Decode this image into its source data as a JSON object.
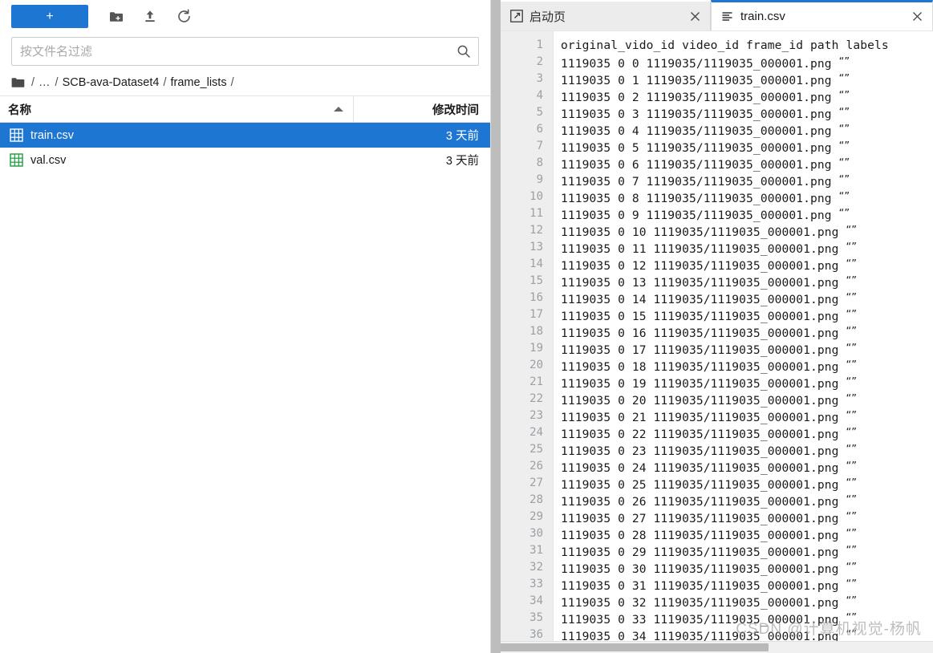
{
  "file_browser": {
    "toolbar": {
      "new_label": "+",
      "icons": [
        {
          "name": "new-folder-icon"
        },
        {
          "name": "upload-icon"
        },
        {
          "name": "refresh-icon"
        }
      ]
    },
    "filter": {
      "value": "",
      "placeholder": "按文件名过滤",
      "icon": "search-icon"
    },
    "breadcrumb": {
      "root_icon": "folder-icon",
      "separator": "/",
      "crumbs": [
        "…",
        "SCB-ava-Dataset4",
        "frame_lists"
      ]
    },
    "columns": {
      "name": "名称",
      "modified": "修改时间",
      "sort": "ascending"
    },
    "files": [
      {
        "name": "train.csv",
        "modified": "3 天前",
        "icon": "csv-grid-icon",
        "selected": true
      },
      {
        "name": "val.csv",
        "modified": "3 天前",
        "icon": "csv-grid-icon",
        "selected": false
      }
    ]
  },
  "editor": {
    "tabs": [
      {
        "label": "启动页",
        "icon": "launcher-icon",
        "active": false,
        "close": "×"
      },
      {
        "label": "train.csv",
        "icon": "file-lines-icon",
        "active": true,
        "close": "×"
      }
    ],
    "header_line": "original_vido_id video_id frame_id path labels",
    "row_template": {
      "original_vido_id": "1119035",
      "video_id": "0",
      "path": "1119035/1119035_000001.png",
      "labels": "“”"
    },
    "first_line_number": 1,
    "last_line_number": 36,
    "data_start_frame_id": 0,
    "scrollbar": {
      "orientation": "horizontal",
      "thumb_percent": 62
    }
  },
  "watermark": "CSDN @计算机视觉-杨帆"
}
